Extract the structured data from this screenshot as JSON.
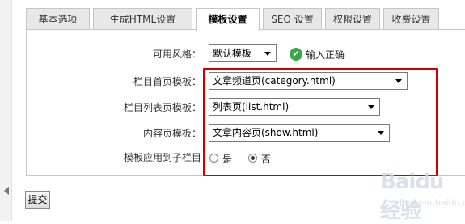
{
  "tabs": [
    {
      "label": "基本选项",
      "active": false
    },
    {
      "label": "生成HTML设置",
      "active": false
    },
    {
      "label": "模板设置",
      "active": true
    },
    {
      "label": "SEO 设置",
      "active": false
    },
    {
      "label": "权限设置",
      "active": false
    },
    {
      "label": "收费设置",
      "active": false
    }
  ],
  "form": {
    "style": {
      "label": "可用风格：",
      "value": "默认模板",
      "status": "输入正确"
    },
    "index_template": {
      "label": "栏目首页模板：",
      "value": "文章频道页(category.html)"
    },
    "list_template": {
      "label": "栏目列表页模板：",
      "value": "列表页(list.html)"
    },
    "content_template": {
      "label": "内容页模板：",
      "value": "文章内容页(show.html)"
    },
    "apply_to_sub": {
      "label": "模板应用到子栏目",
      "options": [
        "是",
        "否"
      ],
      "selected": "否"
    }
  },
  "submit_label": "提交",
  "watermark": {
    "main": "Baidu经验",
    "sub": "jingyan.baidu.com"
  },
  "colors": {
    "highlight_border": "#d10000",
    "ok_icon": "#3aa84a"
  }
}
